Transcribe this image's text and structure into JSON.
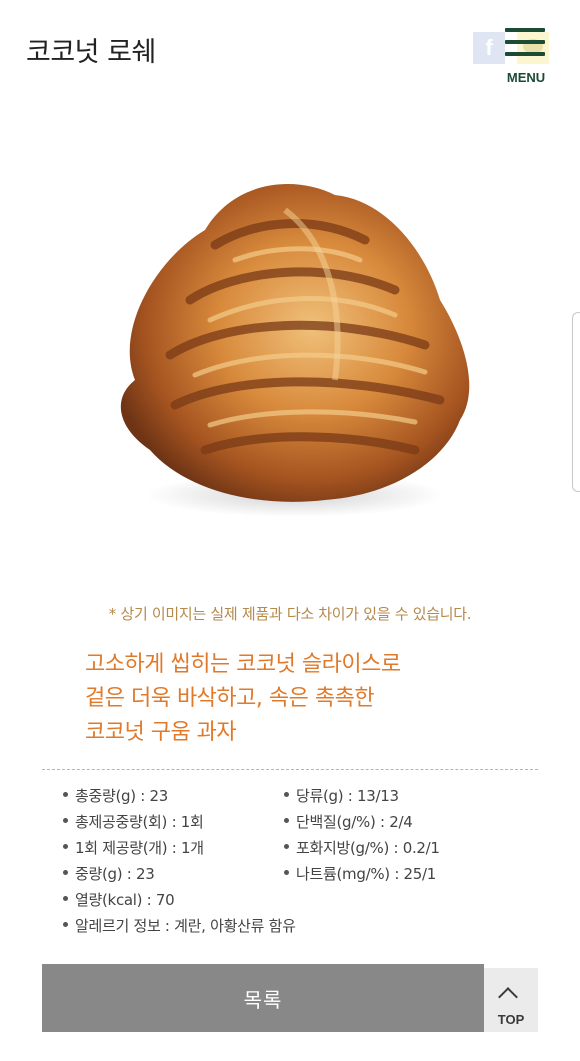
{
  "header": {
    "title": "코코넛 로쉐",
    "facebook_icon_glyph": "f",
    "menu_label": "MENU",
    "brand_color": "#1b4a35"
  },
  "product": {
    "image_subject": "coconut rocher cookie"
  },
  "disclaimer": "* 상기 이미지는 실제 제품과 다소 차이가 있을 수 있습니다.",
  "description": [
    "고소하게 씹히는 코코넛 슬라이스로",
    "겉은 더욱 바삭하고, 속은 촉촉한",
    "코코넛 구움 과자"
  ],
  "specs": {
    "left": [
      "총중량(g) : 23",
      "총제공중량(회) : 1회",
      "1회 제공량(개) : 1개",
      "중량(g) : 23",
      "열량(kcal) : 70",
      "알레르기 정보 : 계란, 아황산류 함유"
    ],
    "right": [
      "당류(g) : 13/13",
      "단백질(g/%) : 2/4",
      "포화지방(g/%) : 0.2/1",
      "나트륨(mg/%) : 25/1"
    ]
  },
  "buttons": {
    "list_label": "목록",
    "top_label": "TOP"
  },
  "colors": {
    "accent_orange": "#e07a2a",
    "disclaimer_gold": "#b58a4c",
    "button_gray": "#888888"
  }
}
